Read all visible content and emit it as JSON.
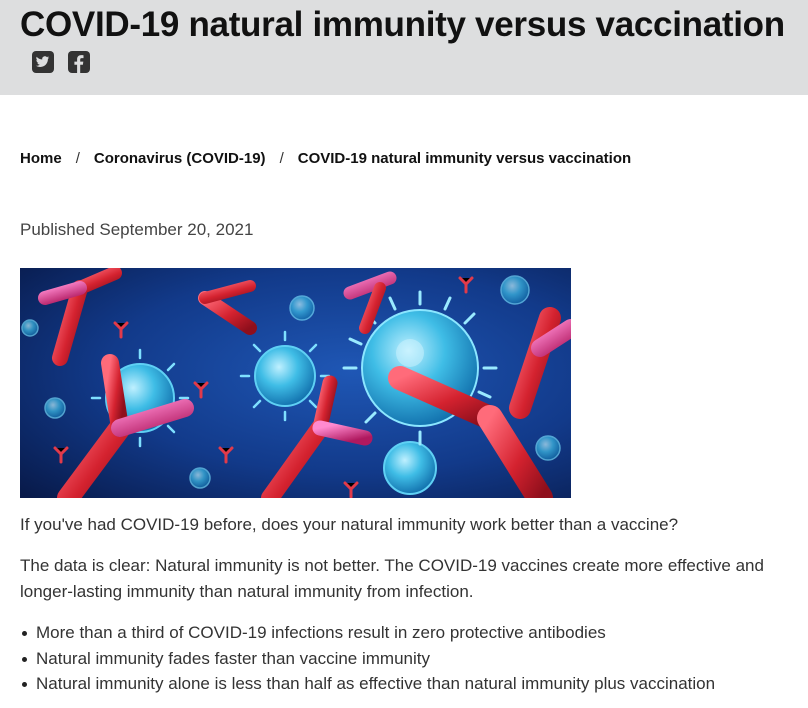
{
  "header": {
    "title": "COVID-19 natural immunity versus vaccination",
    "social": [
      {
        "name": "twitter",
        "icon": "twitter-icon"
      },
      {
        "name": "facebook",
        "icon": "facebook-icon"
      }
    ]
  },
  "breadcrumb": {
    "items": [
      "Home",
      "Coronavirus (COVID-19)",
      "COVID-19 natural immunity versus vaccination"
    ],
    "separator": "/"
  },
  "article": {
    "published": "Published September 20, 2021",
    "intro": "If you've had COVID-19 before, does your natural immunity work better than a vaccine?",
    "summary": "The data is clear: Natural immunity is not better. The COVID-19 vaccines create more effective and longer-lasting immunity than natural immunity from infection.",
    "bullets": [
      "More than a third of COVID-19 infections result in zero protective antibodies",
      "Natural immunity fades faster than vaccine immunity",
      "Natural immunity alone is less than half as effective than natural immunity plus vaccination"
    ]
  },
  "colors": {
    "header_bg": "#dddedf",
    "hero_bg": "#0d2a6e",
    "virus": "#38b8e0",
    "antibody": "#d8283c"
  }
}
